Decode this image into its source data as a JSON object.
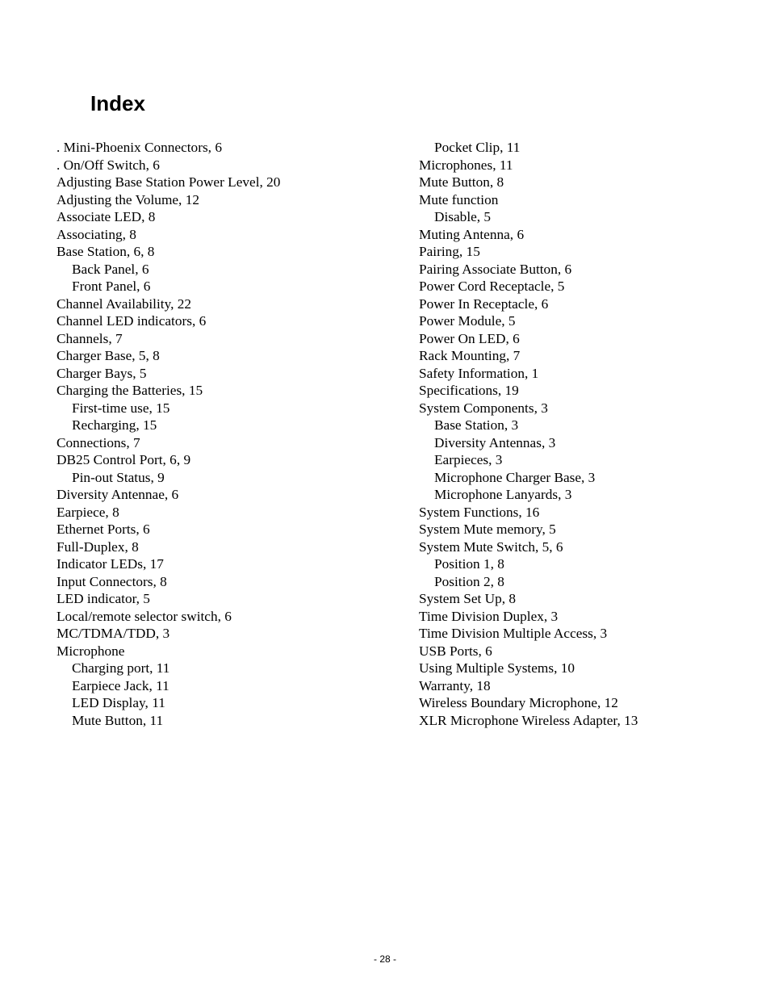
{
  "title": "Index",
  "page_number": "- 28 -",
  "left_column": [
    {
      "text": ". Mini-Phoenix Connectors, 6",
      "level": 0
    },
    {
      "text": ". On/Off Switch, 6",
      "level": 0
    },
    {
      "text": "Adjusting Base Station Power Level, 20",
      "level": 0
    },
    {
      "text": "Adjusting the Volume, 12",
      "level": 0
    },
    {
      "text": "Associate LED, 8",
      "level": 0
    },
    {
      "text": "Associating, 8",
      "level": 0
    },
    {
      "text": "Base Station, 6, 8",
      "level": 0
    },
    {
      "text": "Back Panel, 6",
      "level": 1
    },
    {
      "text": "Front Panel, 6",
      "level": 1
    },
    {
      "text": "Channel Availability, 22",
      "level": 0
    },
    {
      "text": "Channel LED indicators, 6",
      "level": 0
    },
    {
      "text": "Channels, 7",
      "level": 0
    },
    {
      "text": "Charger Base, 5, 8",
      "level": 0
    },
    {
      "text": "Charger Bays, 5",
      "level": 0
    },
    {
      "text": "Charging the Batteries, 15",
      "level": 0
    },
    {
      "text": "First-time use, 15",
      "level": 1
    },
    {
      "text": "Recharging, 15",
      "level": 1
    },
    {
      "text": "Connections, 7",
      "level": 0
    },
    {
      "text": "DB25 Control Port, 6, 9",
      "level": 0
    },
    {
      "text": "Pin-out Status, 9",
      "level": 1
    },
    {
      "text": "Diversity Antennae, 6",
      "level": 0
    },
    {
      "text": "Earpiece, 8",
      "level": 0
    },
    {
      "text": "Ethernet Ports, 6",
      "level": 0
    },
    {
      "text": "Full-Duplex, 8",
      "level": 0
    },
    {
      "text": "Indicator LEDs, 17",
      "level": 0
    },
    {
      "text": "Input Connectors, 8",
      "level": 0
    },
    {
      "text": "LED indicator, 5",
      "level": 0
    },
    {
      "text": "Local/remote selector switch, 6",
      "level": 0
    },
    {
      "text": "MC/TDMA/TDD, 3",
      "level": 0
    },
    {
      "text": "Microphone",
      "level": 0
    },
    {
      "text": "Charging port, 11",
      "level": 1
    },
    {
      "text": "Earpiece Jack, 11",
      "level": 1
    },
    {
      "text": "LED Display, 11",
      "level": 1
    },
    {
      "text": "Mute Button, 11",
      "level": 1
    }
  ],
  "right_column": [
    {
      "text": "Pocket Clip, 11",
      "level": 1
    },
    {
      "text": "Microphones, 11",
      "level": 0
    },
    {
      "text": "Mute Button, 8",
      "level": 0
    },
    {
      "text": "Mute function",
      "level": 0
    },
    {
      "text": "Disable, 5",
      "level": 1
    },
    {
      "text": "Muting Antenna, 6",
      "level": 0
    },
    {
      "text": "Pairing, 15",
      "level": 0
    },
    {
      "text": "Pairing Associate Button, 6",
      "level": 0
    },
    {
      "text": "Power Cord Receptacle, 5",
      "level": 0
    },
    {
      "text": "Power In Receptacle, 6",
      "level": 0
    },
    {
      "text": "Power Module, 5",
      "level": 0
    },
    {
      "text": "Power On LED, 6",
      "level": 0
    },
    {
      "text": "Rack Mounting, 7",
      "level": 0
    },
    {
      "text": "Safety Information, 1",
      "level": 0
    },
    {
      "text": "Specifications, 19",
      "level": 0
    },
    {
      "text": "System Components, 3",
      "level": 0
    },
    {
      "text": "Base Station, 3",
      "level": 1
    },
    {
      "text": "Diversity Antennas, 3",
      "level": 1
    },
    {
      "text": "Earpieces, 3",
      "level": 1
    },
    {
      "text": "Microphone Charger Base, 3",
      "level": 1
    },
    {
      "text": "Microphone Lanyards, 3",
      "level": 1
    },
    {
      "text": "System Functions, 16",
      "level": 0
    },
    {
      "text": "System Mute memory, 5",
      "level": 0
    },
    {
      "text": "System Mute Switch, 5, 6",
      "level": 0
    },
    {
      "text": "Position 1, 8",
      "level": 1
    },
    {
      "text": "Position 2, 8",
      "level": 1
    },
    {
      "text": "System Set Up, 8",
      "level": 0
    },
    {
      "text": "Time Division Duplex, 3",
      "level": 0
    },
    {
      "text": "Time Division Multiple Access, 3",
      "level": 0
    },
    {
      "text": "USB Ports, 6",
      "level": 0
    },
    {
      "text": "Using Multiple Systems, 10",
      "level": 0
    },
    {
      "text": "Warranty, 18",
      "level": 0
    },
    {
      "text": "Wireless Boundary Microphone, 12",
      "level": 0
    },
    {
      "text": "XLR Microphone Wireless Adapter, 13",
      "level": 0
    }
  ]
}
